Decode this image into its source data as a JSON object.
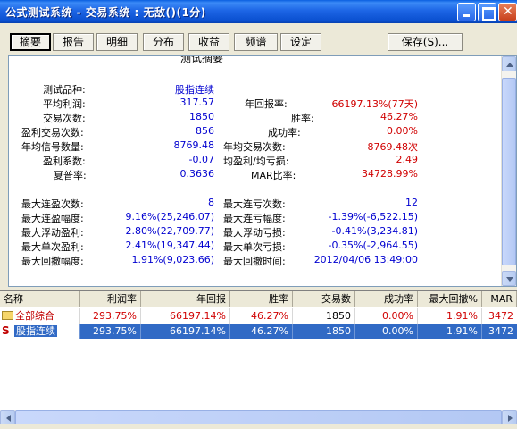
{
  "window": {
    "title": "公式测试系统 - 交易系统 : 无敌()(1分)"
  },
  "toolbar": {
    "tabs": [
      "摘要",
      "报告",
      "明细",
      "分布",
      "收益",
      "频谱",
      "设定"
    ],
    "save_label": "保存(S)..."
  },
  "summary": {
    "heading": "测试摘要",
    "product_label": "测试品种:",
    "product_value": "股指连续",
    "left": [
      {
        "label": "平均利润:",
        "value": "317.57"
      },
      {
        "label": "交易次数:",
        "value": "1850"
      },
      {
        "label": "盈利交易次数:",
        "value": "856"
      },
      {
        "label": "年均信号数量:",
        "value": "8769.48"
      },
      {
        "label": "盈利系数:",
        "value": "-0.07"
      },
      {
        "label": "夏普率:",
        "value": "0.3636"
      }
    ],
    "right": [
      {
        "label": "年回报率:",
        "value": "66197.13%(77天)"
      },
      {
        "label": "胜率:",
        "value": "46.27%"
      },
      {
        "label": "成功率:",
        "value": "0.00%"
      },
      {
        "label": "年均交易次数:",
        "value": "8769.48次"
      },
      {
        "label": "均盈利/均亏损:",
        "value": "2.49"
      },
      {
        "label": "MAR比率:",
        "value": "34728.99%"
      }
    ],
    "left2": [
      {
        "label": "最大连盈次数:",
        "value": "8"
      },
      {
        "label": "最大连盈幅度:",
        "value": "9.16%(25,246.07)"
      },
      {
        "label": "最大浮动盈利:",
        "value": "2.80%(22,709.77)"
      },
      {
        "label": "最大单次盈利:",
        "value": "2.41%(19,347.44)"
      },
      {
        "label": "最大回撤幅度:",
        "value": "1.91%(9,023.66)"
      }
    ],
    "right2": [
      {
        "label": "最大连亏次数:",
        "value": "12"
      },
      {
        "label": "最大连亏幅度:",
        "value": "-1.39%(-6,522.15)"
      },
      {
        "label": "最大浮动亏损:",
        "value": "-0.41%(3,234.81)"
      },
      {
        "label": "最大单次亏损:",
        "value": "-0.35%(-2,964.55)"
      },
      {
        "label": "最大回撤时间:",
        "value": "2012/04/06 13:49:00"
      }
    ]
  },
  "table": {
    "headers": [
      "名称",
      "利润率",
      "年回报",
      "胜率",
      "交易数",
      "成功率",
      "最大回撤%",
      "MAR"
    ],
    "rows": [
      {
        "icon": "folder-icon",
        "name": "全部综合",
        "cells": [
          "293.75%",
          "66197.14%",
          "46.27%",
          "1850",
          "0.00%",
          "1.91%",
          "3472"
        ]
      },
      {
        "icon": "s-icon",
        "name": "股指连续",
        "cells": [
          "293.75%",
          "66197.14%",
          "46.27%",
          "1850",
          "0.00%",
          "1.91%",
          "3472"
        ]
      }
    ]
  },
  "colors": {
    "value_blue": "#0000d0",
    "value_red": "#d00000",
    "selection": "#316ac5"
  }
}
